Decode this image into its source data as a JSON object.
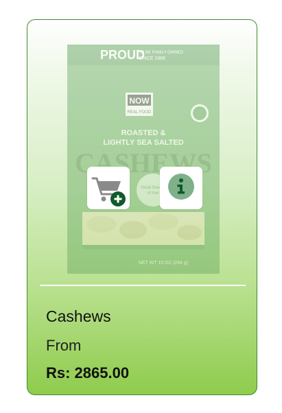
{
  "product": {
    "name": "Cashews",
    "price_prefix": "From",
    "price": "Rs: 2865.00"
  },
  "package_art": {
    "top_banner": "PROUD",
    "top_banner_small_1": "TO BE FAMILY OWNED",
    "top_banner_small_2": "SINCE 1968",
    "brand": "NOW",
    "brand_sub": "REAL FOOD",
    "line1": "ROASTED &",
    "line2": "LIGHTLY SEA SALTED",
    "title": "CASHEWS",
    "badge_line1": "Good Source",
    "badge_line2": "of Iron",
    "net_weight": "NET WT 10 OZ (284 g)"
  },
  "actions": {
    "cart_icon": "add-to-cart-icon",
    "info_icon": "info-icon"
  },
  "colors": {
    "border": "#3f8a2a",
    "gradient_bottom": "#8fcc4c",
    "icon_dark_green": "#0f5a2a",
    "icon_light_green": "#7fb08a",
    "cart_gray": "#8a8a8a"
  }
}
